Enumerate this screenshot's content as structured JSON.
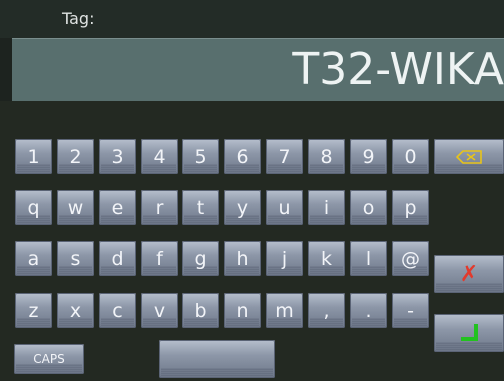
{
  "header": {
    "tag_label": "Tag:"
  },
  "display": {
    "value": "T32-WIKA"
  },
  "keyboard": {
    "row1": [
      "1",
      "2",
      "3",
      "4",
      "5",
      "6",
      "7",
      "8",
      "9",
      "0"
    ],
    "row2": [
      "q",
      "w",
      "e",
      "r",
      "t",
      "y",
      "u",
      "i",
      "o",
      "p"
    ],
    "row3": [
      "a",
      "s",
      "d",
      "f",
      "g",
      "h",
      "j",
      "k",
      "l",
      "@"
    ],
    "row4": [
      "z",
      "x",
      "c",
      "v",
      "b",
      "n",
      "m",
      ",",
      ".",
      "-"
    ],
    "caps_label": "CAPS",
    "space_label": ""
  },
  "icons": {
    "backspace": "backspace-icon",
    "cancel": "cancel-x-icon",
    "enter": "enter-check-icon"
  },
  "colors": {
    "display_bg": "#586f6e",
    "cancel_red": "#e23a2c",
    "enter_green": "#22c21e",
    "backspace_yellow": "#e8c419"
  }
}
